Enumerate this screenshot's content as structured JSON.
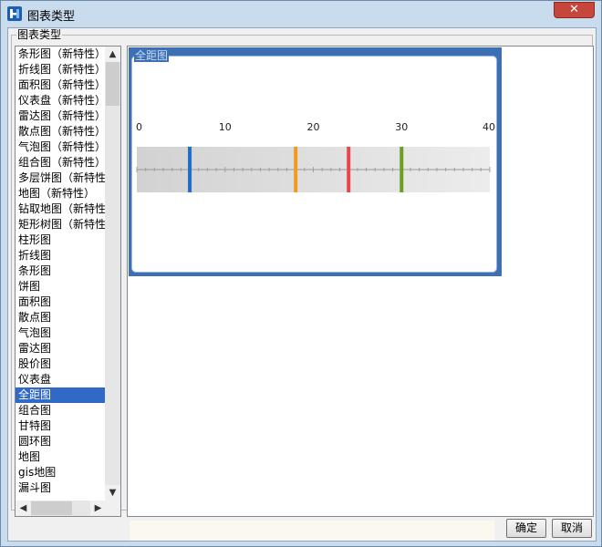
{
  "window": {
    "title": "图表类型",
    "close_label": "✕"
  },
  "group": {
    "label": "图表类型"
  },
  "chart_types": [
    "条形图（新特性）",
    "折线图（新特性）",
    "面积图（新特性）",
    "仪表盘（新特性）",
    "雷达图（新特性）",
    "散点图（新特性）",
    "气泡图（新特性）",
    "组合图（新特性）",
    "多层饼图（新特性",
    "地图（新特性）",
    "钻取地图（新特性）",
    "矩形树图（新特性",
    "柱形图",
    "折线图",
    "条形图",
    "饼图",
    "面积图",
    "散点图",
    "气泡图",
    "雷达图",
    "股价图",
    "仪表盘",
    "全距图",
    "组合图",
    "甘特图",
    "圆环图",
    "地图",
    "gis地图",
    "漏斗图"
  ],
  "selected_type": "全距图",
  "preview": {
    "caption": "全距图",
    "chart_data": {
      "type": "range",
      "xlim": [
        0,
        40
      ],
      "ticks": [
        0,
        10,
        20,
        30,
        40
      ],
      "markers": [
        {
          "value": 6,
          "color": "#1f6fc8"
        },
        {
          "value": 18,
          "color": "#f29a1c"
        },
        {
          "value": 24,
          "color": "#e8474c"
        },
        {
          "value": 30,
          "color": "#6d9d23"
        }
      ]
    }
  },
  "buttons": {
    "ok": "确定",
    "cancel": "取消"
  },
  "icons": {
    "app": "app-logo-icon",
    "close": "close-icon",
    "up": "arrow-up-icon",
    "down": "arrow-down-icon",
    "left": "arrow-left-icon",
    "right": "arrow-right-icon"
  }
}
